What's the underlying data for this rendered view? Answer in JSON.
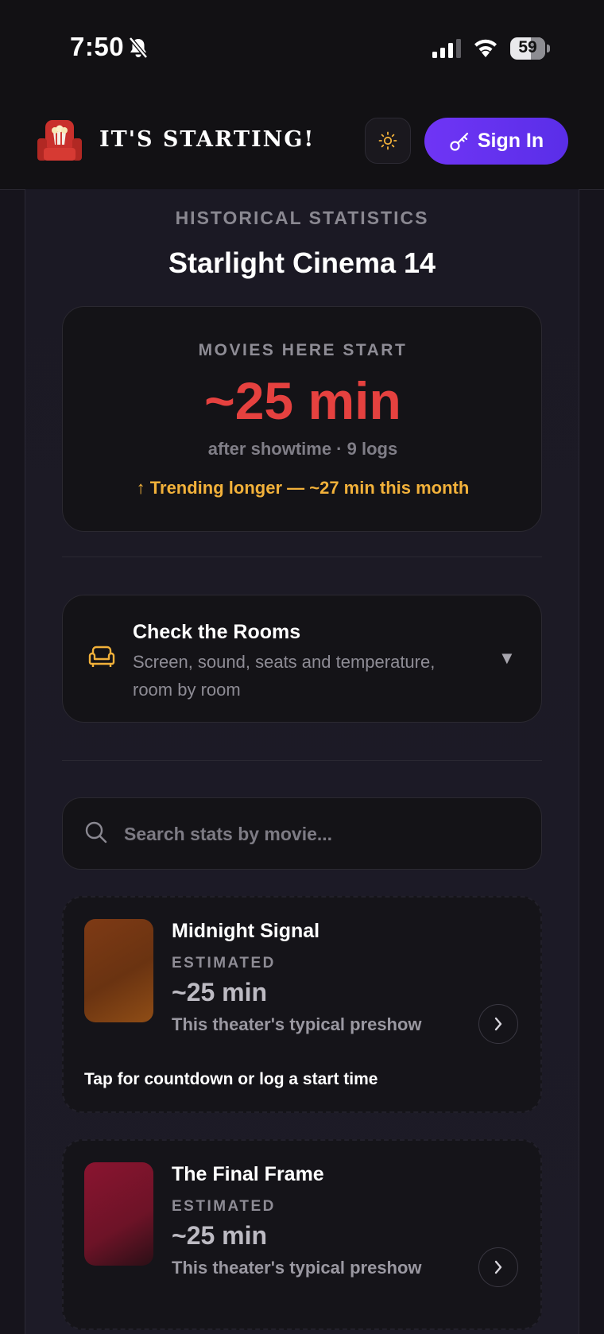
{
  "status": {
    "time": "7:50",
    "battery": "59"
  },
  "header": {
    "app_title": "IT'S STARTING!",
    "sign_in_label": "Sign In"
  },
  "stats": {
    "section_label": "HISTORICAL STATISTICS",
    "theater_name": "Starlight Cinema 14",
    "label": "MOVIES HERE START",
    "value": "~25 min",
    "sub": "after showtime · 9 logs",
    "trend": "↑ Trending longer — ~27 min this month"
  },
  "rooms": {
    "title": "Check the Rooms",
    "description": "Screen, sound, seats and temperature, room by room",
    "chevron": "▼"
  },
  "search": {
    "placeholder": "Search stats by movie..."
  },
  "movies": [
    {
      "title": "Midnight Signal",
      "label": "ESTIMATED",
      "time": "~25 min",
      "note": "This theater's typical preshow",
      "cta": "Tap for countdown or log a start time"
    },
    {
      "title": "The Final Frame",
      "label": "ESTIMATED",
      "time": "~25 min",
      "note": "This theater's typical preshow"
    }
  ],
  "colors": {
    "background": "#16141c",
    "accent_purple": "#6f35f5",
    "stat_red": "#e5413f",
    "trend_amber": "#f2b13a"
  },
  "icons": [
    "bell-slash-icon",
    "cellular-signal-icon",
    "wifi-icon",
    "battery-icon",
    "theater-seat-logo",
    "sun-icon",
    "key-icon",
    "sofa-icon",
    "chevron-down-icon",
    "search-icon",
    "chevron-right-icon"
  ]
}
